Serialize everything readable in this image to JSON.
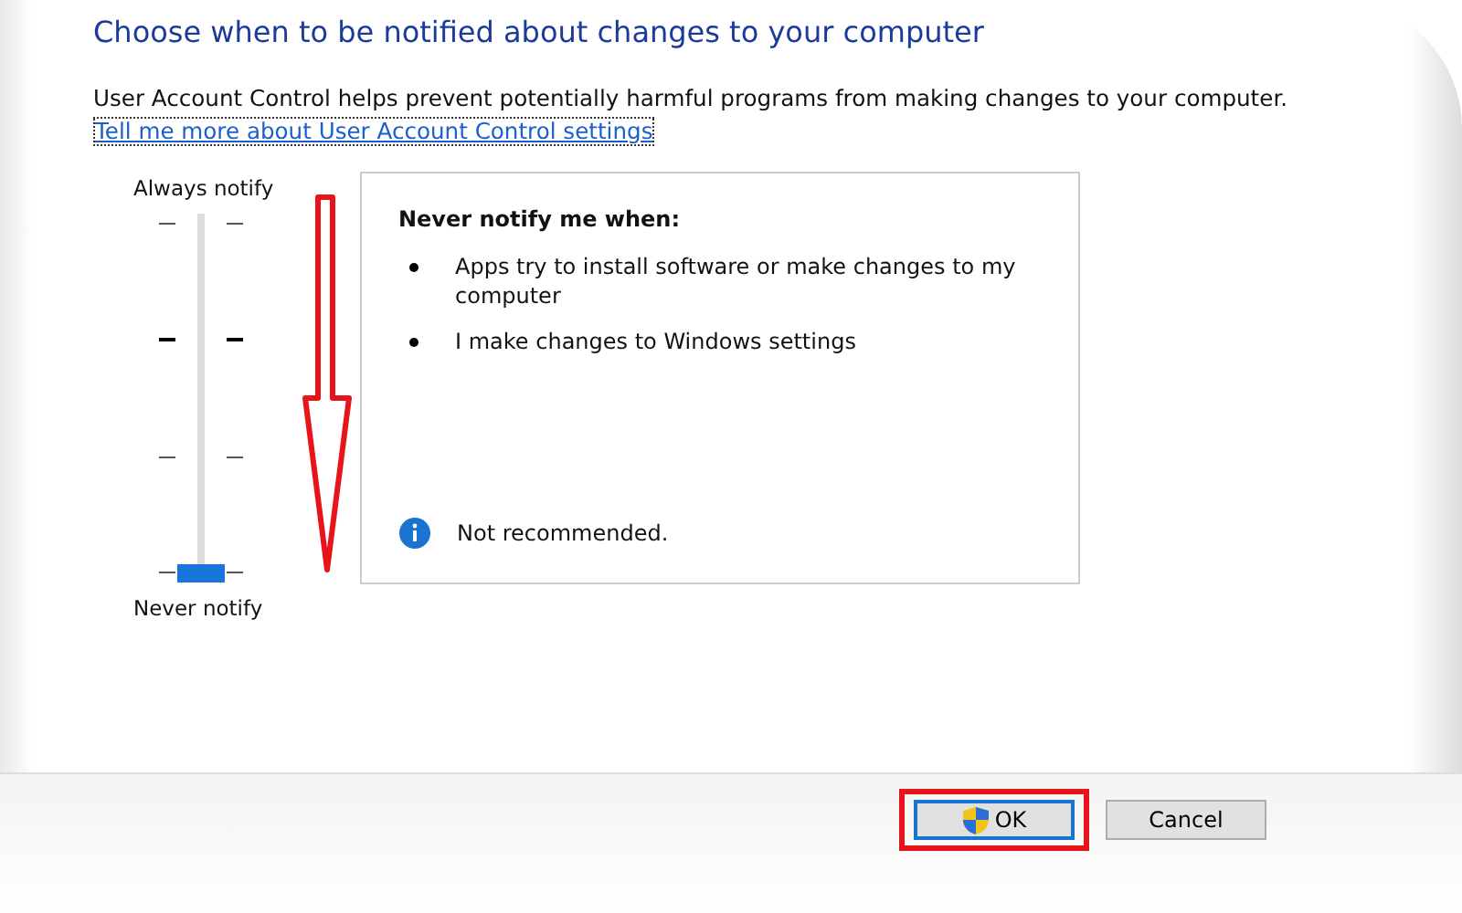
{
  "heading": "Choose when to be notified about changes to your computer",
  "description": "User Account Control helps prevent potentially harmful programs from making changes to your computer.",
  "help_link": "Tell me more about User Account Control settings",
  "slider": {
    "top_label": "Always notify",
    "bottom_label": "Never notify",
    "level": 0
  },
  "info_panel": {
    "title": "Never notify me when:",
    "bullets": [
      "Apps try to install software or make changes to my computer",
      "I make changes to Windows settings"
    ],
    "note": "Not recommended."
  },
  "buttons": [
    {
      "label": "OK",
      "kind": "shield",
      "default": true,
      "highlighted": true
    },
    {
      "label": "Cancel",
      "kind": "plain",
      "default": false,
      "highlighted": false
    }
  ]
}
